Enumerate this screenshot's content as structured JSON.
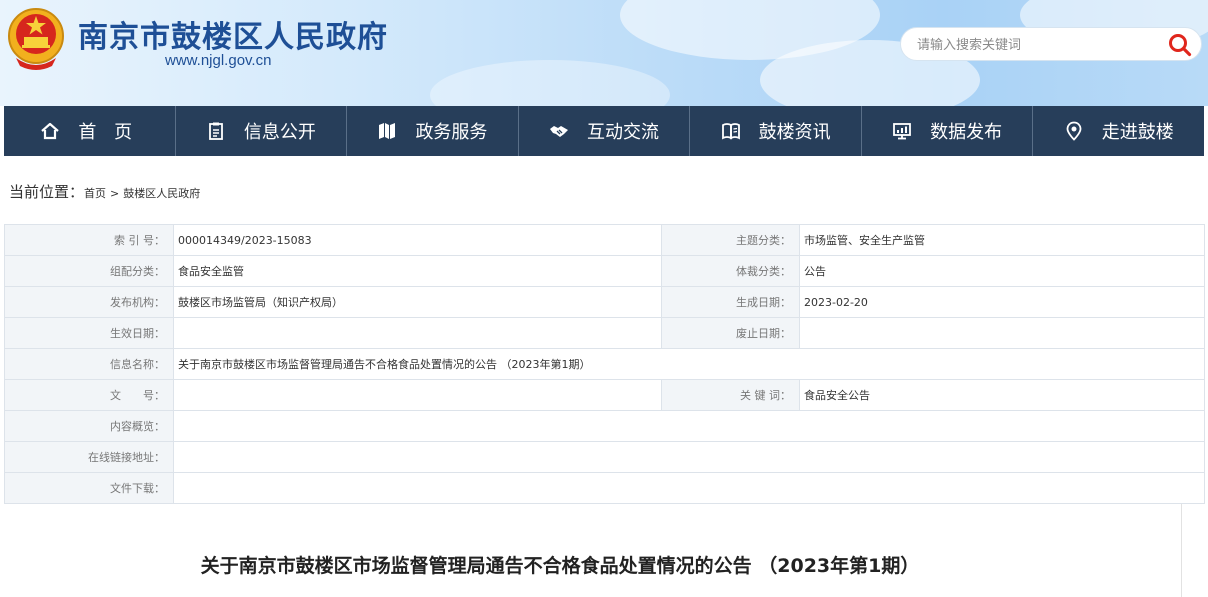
{
  "header": {
    "site_title": "南京市鼓楼区人民政府",
    "site_url": "www.njgl.gov.cn",
    "search_placeholder": "请输入搜索关键词",
    "colors": {
      "title": "#1e4f96",
      "search_icon": "#e0261c"
    }
  },
  "nav": {
    "background": "#273e5a",
    "items": [
      {
        "label": "首 页",
        "icon": "home-icon"
      },
      {
        "label": "信息公开",
        "icon": "document-icon"
      },
      {
        "label": "政务服务",
        "icon": "book-icon"
      },
      {
        "label": "互动交流",
        "icon": "handshake-icon"
      },
      {
        "label": "鼓楼资讯",
        "icon": "open-book-icon"
      },
      {
        "label": "数据发布",
        "icon": "chart-monitor-icon"
      },
      {
        "label": "走进鼓楼",
        "icon": "location-pin-icon"
      }
    ]
  },
  "breadcrumb": {
    "prefix": "当前位置：",
    "items": [
      "首页",
      "鼓楼区人民政府"
    ],
    "separator": ">"
  },
  "meta": {
    "index_no": {
      "label": "索 引 号：",
      "value": "000014349/2023-15083"
    },
    "topic": {
      "label": "主题分类：",
      "value": "市场监管、安全生产监管"
    },
    "org_category": {
      "label": "组配分类：",
      "value": "食品安全监管"
    },
    "genre": {
      "label": "体裁分类：",
      "value": "公告"
    },
    "publisher": {
      "label": "发布机构：",
      "value": "鼓楼区市场监管局（知识产权局）"
    },
    "created": {
      "label": "生成日期：",
      "value": "2023-02-20"
    },
    "effective": {
      "label": "生效日期：",
      "value": ""
    },
    "expired": {
      "label": "废止日期：",
      "value": ""
    },
    "info_name": {
      "label": "信息名称：",
      "value": "关于南京市鼓楼区市场监督管理局通告不合格食品处置情况的公告 （2023年第1期）"
    },
    "doc_no": {
      "label": "文　　号：",
      "value": ""
    },
    "keywords": {
      "label": "关 键 词：",
      "value": "食品安全公告"
    },
    "summary": {
      "label": "内容概览：",
      "value": ""
    },
    "online_link": {
      "label": "在线链接地址：",
      "value": ""
    },
    "download": {
      "label": "文件下载：",
      "value": ""
    }
  },
  "article": {
    "title": "关于南京市鼓楼区市场监督管理局通告不合格食品处置情况的公告 （2023年第1期）"
  }
}
